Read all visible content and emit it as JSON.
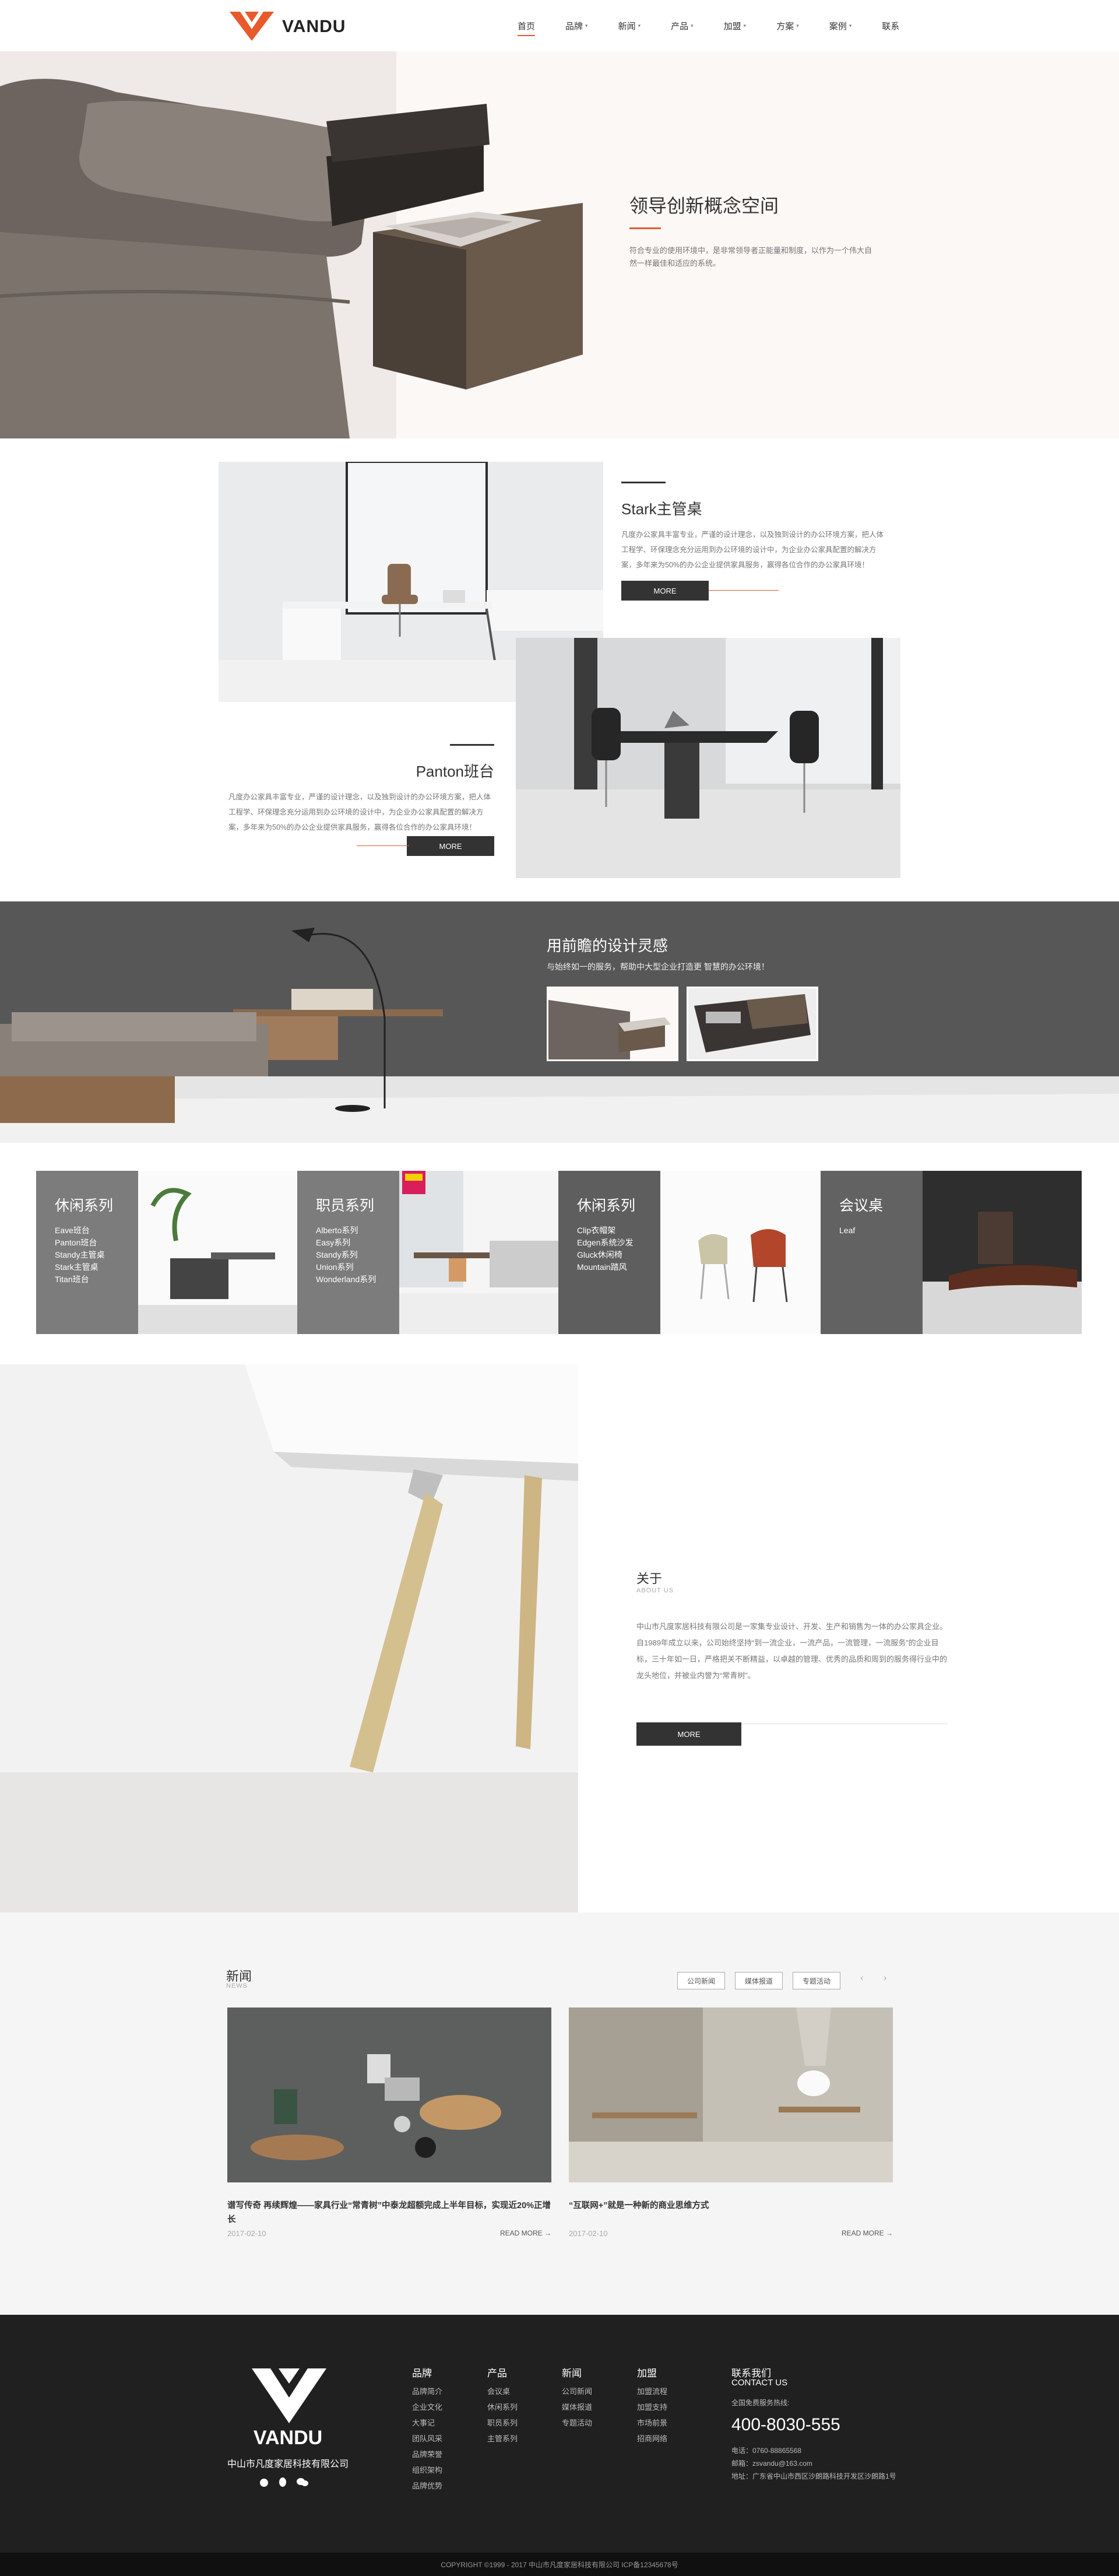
{
  "brand": {
    "name": "VANDU",
    "accent": "#e85a2b"
  },
  "nav": {
    "items": [
      {
        "label": "首页",
        "dropdown": false,
        "active": true
      },
      {
        "label": "品牌",
        "dropdown": true
      },
      {
        "label": "新闻",
        "dropdown": true
      },
      {
        "label": "产品",
        "dropdown": true
      },
      {
        "label": "加盟",
        "dropdown": true
      },
      {
        "label": "方案",
        "dropdown": true
      },
      {
        "label": "案例",
        "dropdown": true
      },
      {
        "label": "联系",
        "dropdown": false
      }
    ]
  },
  "hero": {
    "title": "领导创新概念空间",
    "desc": "符合专业的使用环境中，是非常领导者正能量和制度，以作为一个伟大自然一样最佳和适应的系统。"
  },
  "products": [
    {
      "title": "Stark主管桌",
      "desc": "凡度办公家具丰富专业，严谨的设计理念，以及独到设计的办公环境方案，把人体工程学、环保理念充分运用到办公环境的设计中，为企业办公家具配置的解决方案，多年来为50%的办公企业提供家具服务，赢得各位合作的办公家具环境！",
      "more": "MORE"
    },
    {
      "title": "Panton班台",
      "desc": "凡度办公家具丰富专业，严谨的设计理念，以及独到设计的办公环境方案，把人体工程学、环保理念充分运用到办公环境的设计中，为企业办公家具配置的解决方案，多年来为50%的办公企业提供家具服务，赢得各位合作的办公家具环境！",
      "more": "MORE"
    }
  ],
  "design": {
    "title": "用前瞻的设计灵感",
    "sub": "与始终如一的服务，帮助中大型企业打造更 智慧的办公环境！"
  },
  "series": [
    {
      "title": "休闲系列",
      "items": [
        "Eave班台",
        "Panton班台",
        "Standy主管桌",
        "Stark主管桌",
        "Titan班台"
      ]
    },
    {
      "title": "职员系列",
      "items": [
        "Alberto系列",
        "Easy系列",
        "Standy系列",
        "Union系列",
        "Wonderland系列"
      ]
    },
    {
      "title": "休闲系列",
      "items": [
        "Clip衣帽架",
        "Edgen系统沙发",
        "Gluck休闲椅",
        "Mountain踏风"
      ]
    },
    {
      "title": "会议桌",
      "items": [
        "Leaf"
      ]
    }
  ],
  "about": {
    "title": "关于",
    "sub": "ABOUT US",
    "desc": "中山市凡度家居科技有限公司是一家集专业设计、开发、生产和销售为一体的办公家具企业。自1989年成立以来，公司始终坚持“到一流企业，一流产品，一流管理，一流服务”的企业目标，三十年如一日，严格把关不断精益，以卓越的管理、优秀的品质和周到的服务得行业中的龙头地位，并被业内誉为“常青树”。",
    "more": "MORE"
  },
  "news": {
    "title": "新闻",
    "sub": "NEWS",
    "tabs": [
      "公司新闻",
      "媒体报道",
      "专题活动"
    ],
    "prev": "‹",
    "next": "›",
    "items": [
      {
        "title": "谱写传奇 再续辉煌——家具行业“常青树”中泰龙超额完成上半年目标，实现近20%正增长",
        "date": "2017-02-10",
        "more": "READ MORE →"
      },
      {
        "title": "“互联网+”就是一种新的商业思维方式",
        "date": "2017-02-10",
        "more": "READ MORE →"
      }
    ]
  },
  "footer": {
    "company": "中山市凡度家居科技有限公司",
    "columns": [
      {
        "title": "品牌",
        "items": [
          "品牌简介",
          "企业文化",
          "大事记",
          "团队风采",
          "品牌荣誉",
          "组织架构",
          "品牌优势"
        ]
      },
      {
        "title": "产品",
        "items": [
          "会议桌",
          "休闲系列",
          "职员系列",
          "主管系列"
        ]
      },
      {
        "title": "新闻",
        "items": [
          "公司新闻",
          "媒体报道",
          "专题活动"
        ]
      },
      {
        "title": "加盟",
        "items": [
          "加盟流程",
          "加盟支持",
          "市场前景",
          "招商网络"
        ]
      }
    ],
    "contact": {
      "title": "联系我们",
      "sub": "CONTACT US",
      "hotline_label": "全国免费服务热线:",
      "phone": "400-8030-555",
      "tel": "电话：0760-88865568",
      "email": "邮箱：zsvandu@163.com",
      "address": "地址：广东省中山市西区沙朗路科技开发区沙朗路1号"
    },
    "copyright": "COPYRIGHT ©1999 - 2017 中山市凡度家居科技有限公司   ICP备12345678号"
  }
}
